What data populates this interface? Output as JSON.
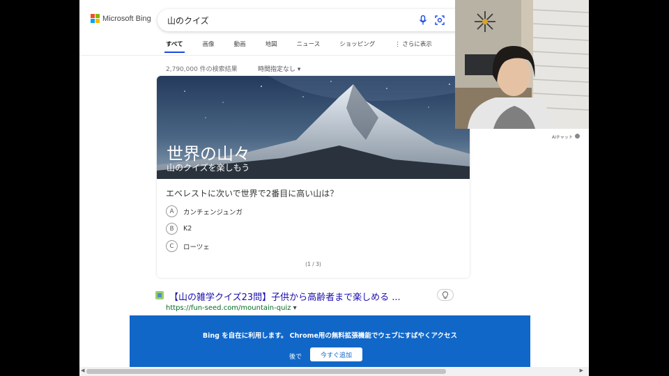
{
  "header": {
    "logo_text": "Microsoft Bing"
  },
  "search": {
    "query": "山のクイズ"
  },
  "tabs": [
    {
      "label": "すべて"
    },
    {
      "label": "画像"
    },
    {
      "label": "動画"
    },
    {
      "label": "地図"
    },
    {
      "label": "ニュース"
    },
    {
      "label": "ショッピング"
    },
    {
      "label": "さらに表示"
    }
  ],
  "results": {
    "count": "2,790,000 件の検索結果",
    "time_filter": "時間指定なし"
  },
  "quiz": {
    "hero_title": "世界の山々",
    "hero_subtitle": "山のクイズを楽しもう",
    "question": "エベレストに次いで世界で2番目に高い山は？",
    "options": [
      {
        "letter": "A",
        "text": "カンチェンジュンガ"
      },
      {
        "letter": "B",
        "text": "K2"
      },
      {
        "letter": "C",
        "text": "ローツェ"
      }
    ],
    "page": "(1 / 3)"
  },
  "result1": {
    "title": "【山の雑学クイズ23問】子供から高齢者まで楽しめる ...",
    "url": "https://fun-seed.com/mountain-quiz"
  },
  "banner": {
    "text": "Bing を自在に利用します。 Chrome用の無料拡張機能でウェブにすばやくアクセス",
    "later": "後で",
    "add": "今すぐ追加"
  },
  "side": {
    "ai_chat": "AIチャット"
  },
  "colors": {
    "bing_blue": "#174ae4",
    "banner_blue": "#1167c8",
    "link": "#1a0dab",
    "url_green": "#006d21"
  }
}
